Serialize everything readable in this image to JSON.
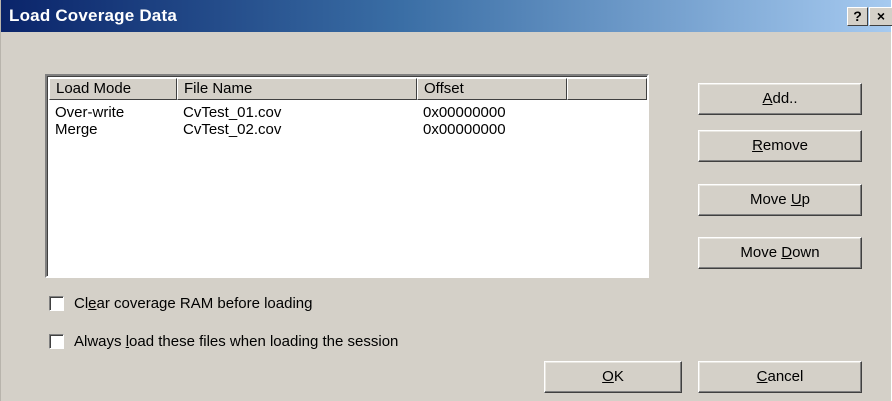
{
  "window": {
    "title": "Load Coverage Data",
    "help_glyph": "?",
    "close_glyph": "×"
  },
  "table": {
    "columns": [
      "Load Mode",
      "File Name",
      "Offset",
      ""
    ],
    "rows": [
      {
        "load_mode": "Over-write",
        "file_name": "CvTest_01.cov",
        "offset": "0x00000000"
      },
      {
        "load_mode": "Merge",
        "file_name": "CvTest_02.cov",
        "offset": "0x00000000"
      }
    ]
  },
  "buttons": {
    "add": {
      "mnemonic": "A",
      "rest": "dd.."
    },
    "remove": {
      "mnemonic": "R",
      "rest": "emove"
    },
    "move_up": {
      "prefix": "Move ",
      "mnemonic": "U",
      "rest": "p"
    },
    "move_down": {
      "prefix": "Move ",
      "mnemonic": "D",
      "rest": "own"
    },
    "ok": {
      "mnemonic": "O",
      "rest": "K"
    },
    "cancel": {
      "mnemonic": "C",
      "rest": "ancel"
    }
  },
  "options": {
    "clear_ram": {
      "prefix": "Cl",
      "mnemonic": "e",
      "rest": "ar coverage RAM before loading",
      "checked": false
    },
    "always_load": {
      "prefix": "Always ",
      "mnemonic": "l",
      "rest": "oad these files when loading the session",
      "checked": false
    }
  }
}
